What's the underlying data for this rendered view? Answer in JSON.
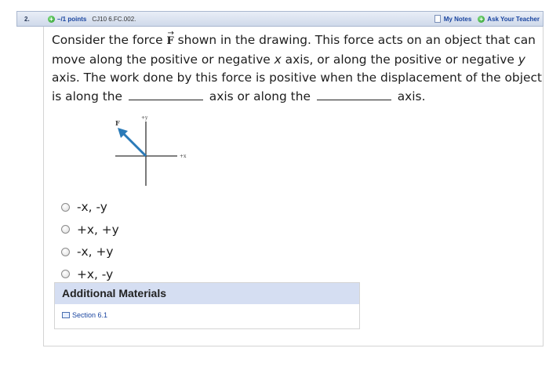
{
  "header": {
    "question_number": "2.",
    "points": "–/1 points",
    "question_code": "CJ10 6.FC.002.",
    "my_notes": "My Notes",
    "ask_teacher": "Ask Your Teacher"
  },
  "question": {
    "part1": "Consider the force ",
    "force_symbol": "F",
    "part2": " shown in the drawing. This force acts on an object that can move along the positive or negative ",
    "x_var": "x",
    "part3": " axis, or along the positive or negative ",
    "y_var": "y",
    "part4": " axis. The work done by this force is positive when the displacement of the object is along the ",
    "part5": " axis or along the ",
    "part6": " axis."
  },
  "figure": {
    "force_label": "F",
    "plus_y_label": "+y",
    "plus_x_label": "+x",
    "arrow_color": "#2a7ab8"
  },
  "options": [
    {
      "label": "-x, -y"
    },
    {
      "label": "+x, +y"
    },
    {
      "label": "-x, +y"
    },
    {
      "label": "+x, -y"
    }
  ],
  "materials": {
    "heading": "Additional Materials",
    "link": "Section 6.1"
  },
  "icons": {
    "plus": "plus-circle-icon",
    "notes": "notes-icon",
    "book": "book-icon"
  }
}
